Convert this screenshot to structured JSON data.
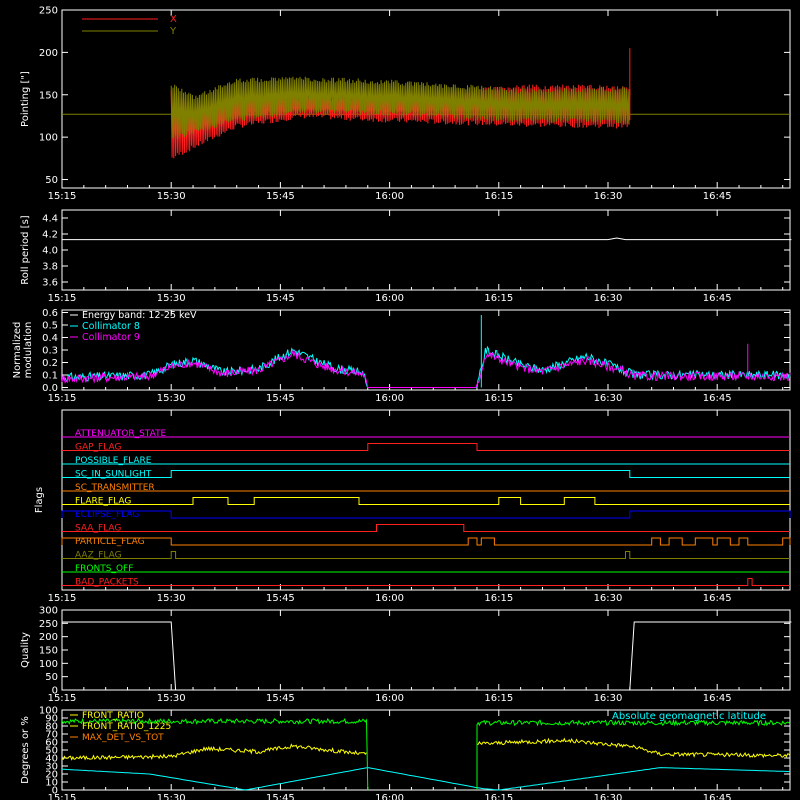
{
  "colors": {
    "background": "#000000",
    "axis": "#ffffff",
    "x_red": "#ff2020",
    "y_olive": "#808000",
    "cyan": "#00ffff",
    "magenta": "#ff00ff",
    "yellow": "#ffff00",
    "green": "#00ff00",
    "orange": "#ff8000",
    "blue": "#0000ff"
  },
  "chart_data": [
    {
      "id": "pointing",
      "type": "line",
      "ylabel": "Pointing [\"]",
      "ylim": [
        40,
        250
      ],
      "yticks": [
        50,
        100,
        150,
        200,
        250
      ],
      "x_ticks": [
        "15:15",
        "15:30",
        "15:45",
        "16:00",
        "16:15",
        "16:30",
        "16:45"
      ],
      "series": [
        {
          "name": "X",
          "color": "#ff2020",
          "band": {
            "x": [
              15.5,
              15.55,
              15.65,
              15.8,
              16.0,
              16.3,
              16.55
            ],
            "lo": [
              72,
              85,
              110,
              122,
              117,
              112,
              110
            ],
            "hi": [
              158,
              140,
              148,
              148,
              150,
              162,
              162
            ]
          },
          "spike": {
            "x": 16.55,
            "y": 205
          }
        },
        {
          "name": "Y",
          "color": "#808000",
          "band": {
            "x": [
              15.5,
              15.55,
              15.65,
              15.8,
              16.0,
              16.3,
              16.55
            ],
            "lo": [
              95,
              103,
              118,
              128,
              125,
              117,
              115
            ],
            "hi": [
              165,
              150,
              170,
              172,
              168,
              158,
              160
            ]
          },
          "reference_y": 127
        }
      ]
    },
    {
      "id": "roll",
      "type": "line",
      "ylabel": "Roll period [s]",
      "ylim": [
        3.5,
        4.5
      ],
      "yticks": [
        3.6,
        3.8,
        4.0,
        4.2,
        4.4
      ],
      "ytick_labels": [
        "3.6",
        "3.8",
        "4.0",
        "4.2",
        "4.4"
      ],
      "x_ticks": [
        "15:15",
        "15:30",
        "15:45",
        "16:00",
        "16:15",
        "16:30",
        "16:45"
      ],
      "series": [
        {
          "color": "#ffffff",
          "x": [
            15.25,
            16.5,
            16.52,
            16.54,
            16.92
          ],
          "y": [
            4.13,
            4.13,
            4.15,
            4.13,
            4.13
          ]
        }
      ]
    },
    {
      "id": "modulation",
      "type": "line",
      "ylabel": "Normalized modulation",
      "ylim": [
        -0.02,
        0.62
      ],
      "yticks": [
        0.0,
        0.1,
        0.2,
        0.3,
        0.4,
        0.5,
        0.6
      ],
      "ytick_labels": [
        "0.0",
        "0.1",
        "0.2",
        "0.3",
        "0.4",
        "0.5",
        "0.6"
      ],
      "x_ticks": [
        "15:15",
        "15:30",
        "15:45",
        "16:00",
        "16:15",
        "16:30",
        "16:45"
      ],
      "legend": {
        "title": "Energy band: 12-25 keV",
        "items": [
          "Collimator 8",
          "Collimator 9"
        ]
      },
      "series": [
        {
          "name": "Collimator 8",
          "color": "#00ffff",
          "x": [
            15.25,
            15.45,
            15.5,
            15.55,
            15.62,
            15.7,
            15.78,
            15.84,
            15.88,
            15.92,
            15.94,
            15.95,
            16.2,
            16.22,
            16.3,
            16.35,
            16.45,
            16.52,
            16.56,
            16.7,
            16.92
          ],
          "y": [
            0.08,
            0.1,
            0.18,
            0.22,
            0.12,
            0.15,
            0.3,
            0.2,
            0.15,
            0.13,
            0.12,
            0.0,
            0.0,
            0.3,
            0.18,
            0.14,
            0.25,
            0.16,
            0.1,
            0.1,
            0.1
          ]
        },
        {
          "name": "Collimator 9",
          "color": "#ff00ff",
          "x": [
            15.25,
            15.45,
            15.5,
            15.55,
            15.62,
            15.7,
            15.78,
            15.84,
            15.88,
            15.92,
            15.94,
            15.95,
            16.2,
            16.22,
            16.3,
            16.35,
            16.45,
            16.52,
            16.56,
            16.7,
            16.92
          ],
          "y": [
            0.07,
            0.09,
            0.17,
            0.2,
            0.11,
            0.14,
            0.27,
            0.18,
            0.14,
            0.12,
            0.11,
            0.0,
            0.0,
            0.27,
            0.16,
            0.13,
            0.22,
            0.15,
            0.09,
            0.09,
            0.09
          ]
        }
      ]
    },
    {
      "id": "flags",
      "type": "step",
      "ylabel": "Flags",
      "x_ticks": [
        "15:15",
        "15:30",
        "15:45",
        "16:00",
        "16:15",
        "16:30",
        "16:45"
      ],
      "rows": [
        {
          "label": "ATTENUATOR_STATE",
          "color": "#ff00ff",
          "steps": []
        },
        {
          "label": "GAP_FLAG",
          "color": "#ff2020",
          "steps": [
            [
              15.95,
              16.2
            ]
          ]
        },
        {
          "label": "POSSIBLE_FLARE",
          "color": "#00ffff",
          "steps": []
        },
        {
          "label": "SC_IN_SUNLIGHT",
          "color": "#00ffff",
          "steps": [
            [
              15.5,
              16.55
            ]
          ]
        },
        {
          "label": "SC_TRANSMITTER",
          "color": "#ff8000",
          "steps": []
        },
        {
          "label": "FLARE_FLAG",
          "color": "#ffff00",
          "steps": [
            [
              15.55,
              15.63
            ],
            [
              15.69,
              15.93
            ],
            [
              16.25,
              16.3
            ],
            [
              16.4,
              16.47
            ]
          ]
        },
        {
          "label": "ECLIPSE_FLAG",
          "color": "#0000ff",
          "steps": [
            [
              15.25,
              15.5
            ],
            [
              16.55,
              16.92
            ]
          ]
        },
        {
          "label": "SAA_FLAG",
          "color": "#ff2020",
          "steps": [
            [
              15.97,
              16.17
            ]
          ]
        },
        {
          "label": "PARTICLE_FLAG",
          "color": "#ff8000",
          "steps": [
            [
              15.25,
              15.5
            ],
            [
              16.18,
              16.2
            ],
            [
              16.21,
              16.24
            ],
            [
              16.6,
              16.62
            ],
            [
              16.64,
              16.67
            ],
            [
              16.7,
              16.74
            ],
            [
              16.75,
              16.78
            ],
            [
              16.8,
              16.82
            ],
            [
              16.9,
              16.92
            ]
          ]
        },
        {
          "label": "AAZ_FLAG",
          "color": "#808000",
          "steps": [
            [
              15.5,
              15.51
            ],
            [
              16.54,
              16.55
            ]
          ]
        },
        {
          "label": "FRONTS_OFF",
          "color": "#00ff00",
          "steps": []
        },
        {
          "label": "BAD_PACKETS",
          "color": "#ff2020",
          "steps": [
            [
              16.82,
              16.83
            ]
          ]
        }
      ]
    },
    {
      "id": "quality",
      "type": "line",
      "ylabel": "Quality",
      "ylim": [
        0,
        300
      ],
      "yticks": [
        0,
        50,
        100,
        150,
        200,
        250,
        300
      ],
      "x_ticks": [
        "15:15",
        "15:30",
        "15:45",
        "16:00",
        "16:15",
        "16:30",
        "16:45"
      ],
      "series": [
        {
          "color": "#ffffff",
          "x": [
            15.25,
            15.5,
            15.51,
            16.55,
            16.56,
            16.92
          ],
          "y": [
            255,
            255,
            0,
            0,
            255,
            255
          ]
        }
      ]
    },
    {
      "id": "geo",
      "type": "line",
      "ylabel": "Degrees or %",
      "ylim": [
        0,
        100
      ],
      "yticks": [
        0,
        10,
        20,
        30,
        40,
        50,
        60,
        70,
        80,
        90,
        100
      ],
      "x_ticks": [
        "15:15",
        "15:30",
        "15:45",
        "16:00",
        "16:15",
        "16:30",
        "16:45"
      ],
      "legend_left": [
        "FRONT_RATIO",
        "FRONT_RATIO_1225",
        "MAX_DET_VS_TOT"
      ],
      "legend_right": "Absolute geomagnetic latitude",
      "series": [
        {
          "name": "FRONT_RATIO",
          "color": "#00ff00",
          "x": [
            15.25,
            15.94,
            15.95,
            15.95,
            16.2,
            16.2,
            16.21,
            16.92
          ],
          "y": [
            85,
            88,
            88,
            0,
            0,
            82,
            84,
            88
          ]
        },
        {
          "name": "MAX_DET_VS_TOT",
          "color": "#ffff00",
          "x": [
            15.25,
            15.5,
            15.58,
            15.7,
            15.78,
            15.94,
            16.21,
            16.4,
            16.55,
            16.62,
            16.92
          ],
          "y": [
            40,
            42,
            52,
            48,
            55,
            45,
            58,
            62,
            55,
            45,
            43
          ]
        },
        {
          "name": "Absolute geomagnetic latitude",
          "color": "#00ffff",
          "x": [
            15.25,
            15.45,
            15.67,
            15.95,
            16.21,
            16.25,
            16.45,
            16.62,
            16.92
          ],
          "y": [
            26,
            20,
            0,
            28,
            2,
            0,
            15,
            28,
            23
          ]
        }
      ]
    }
  ]
}
